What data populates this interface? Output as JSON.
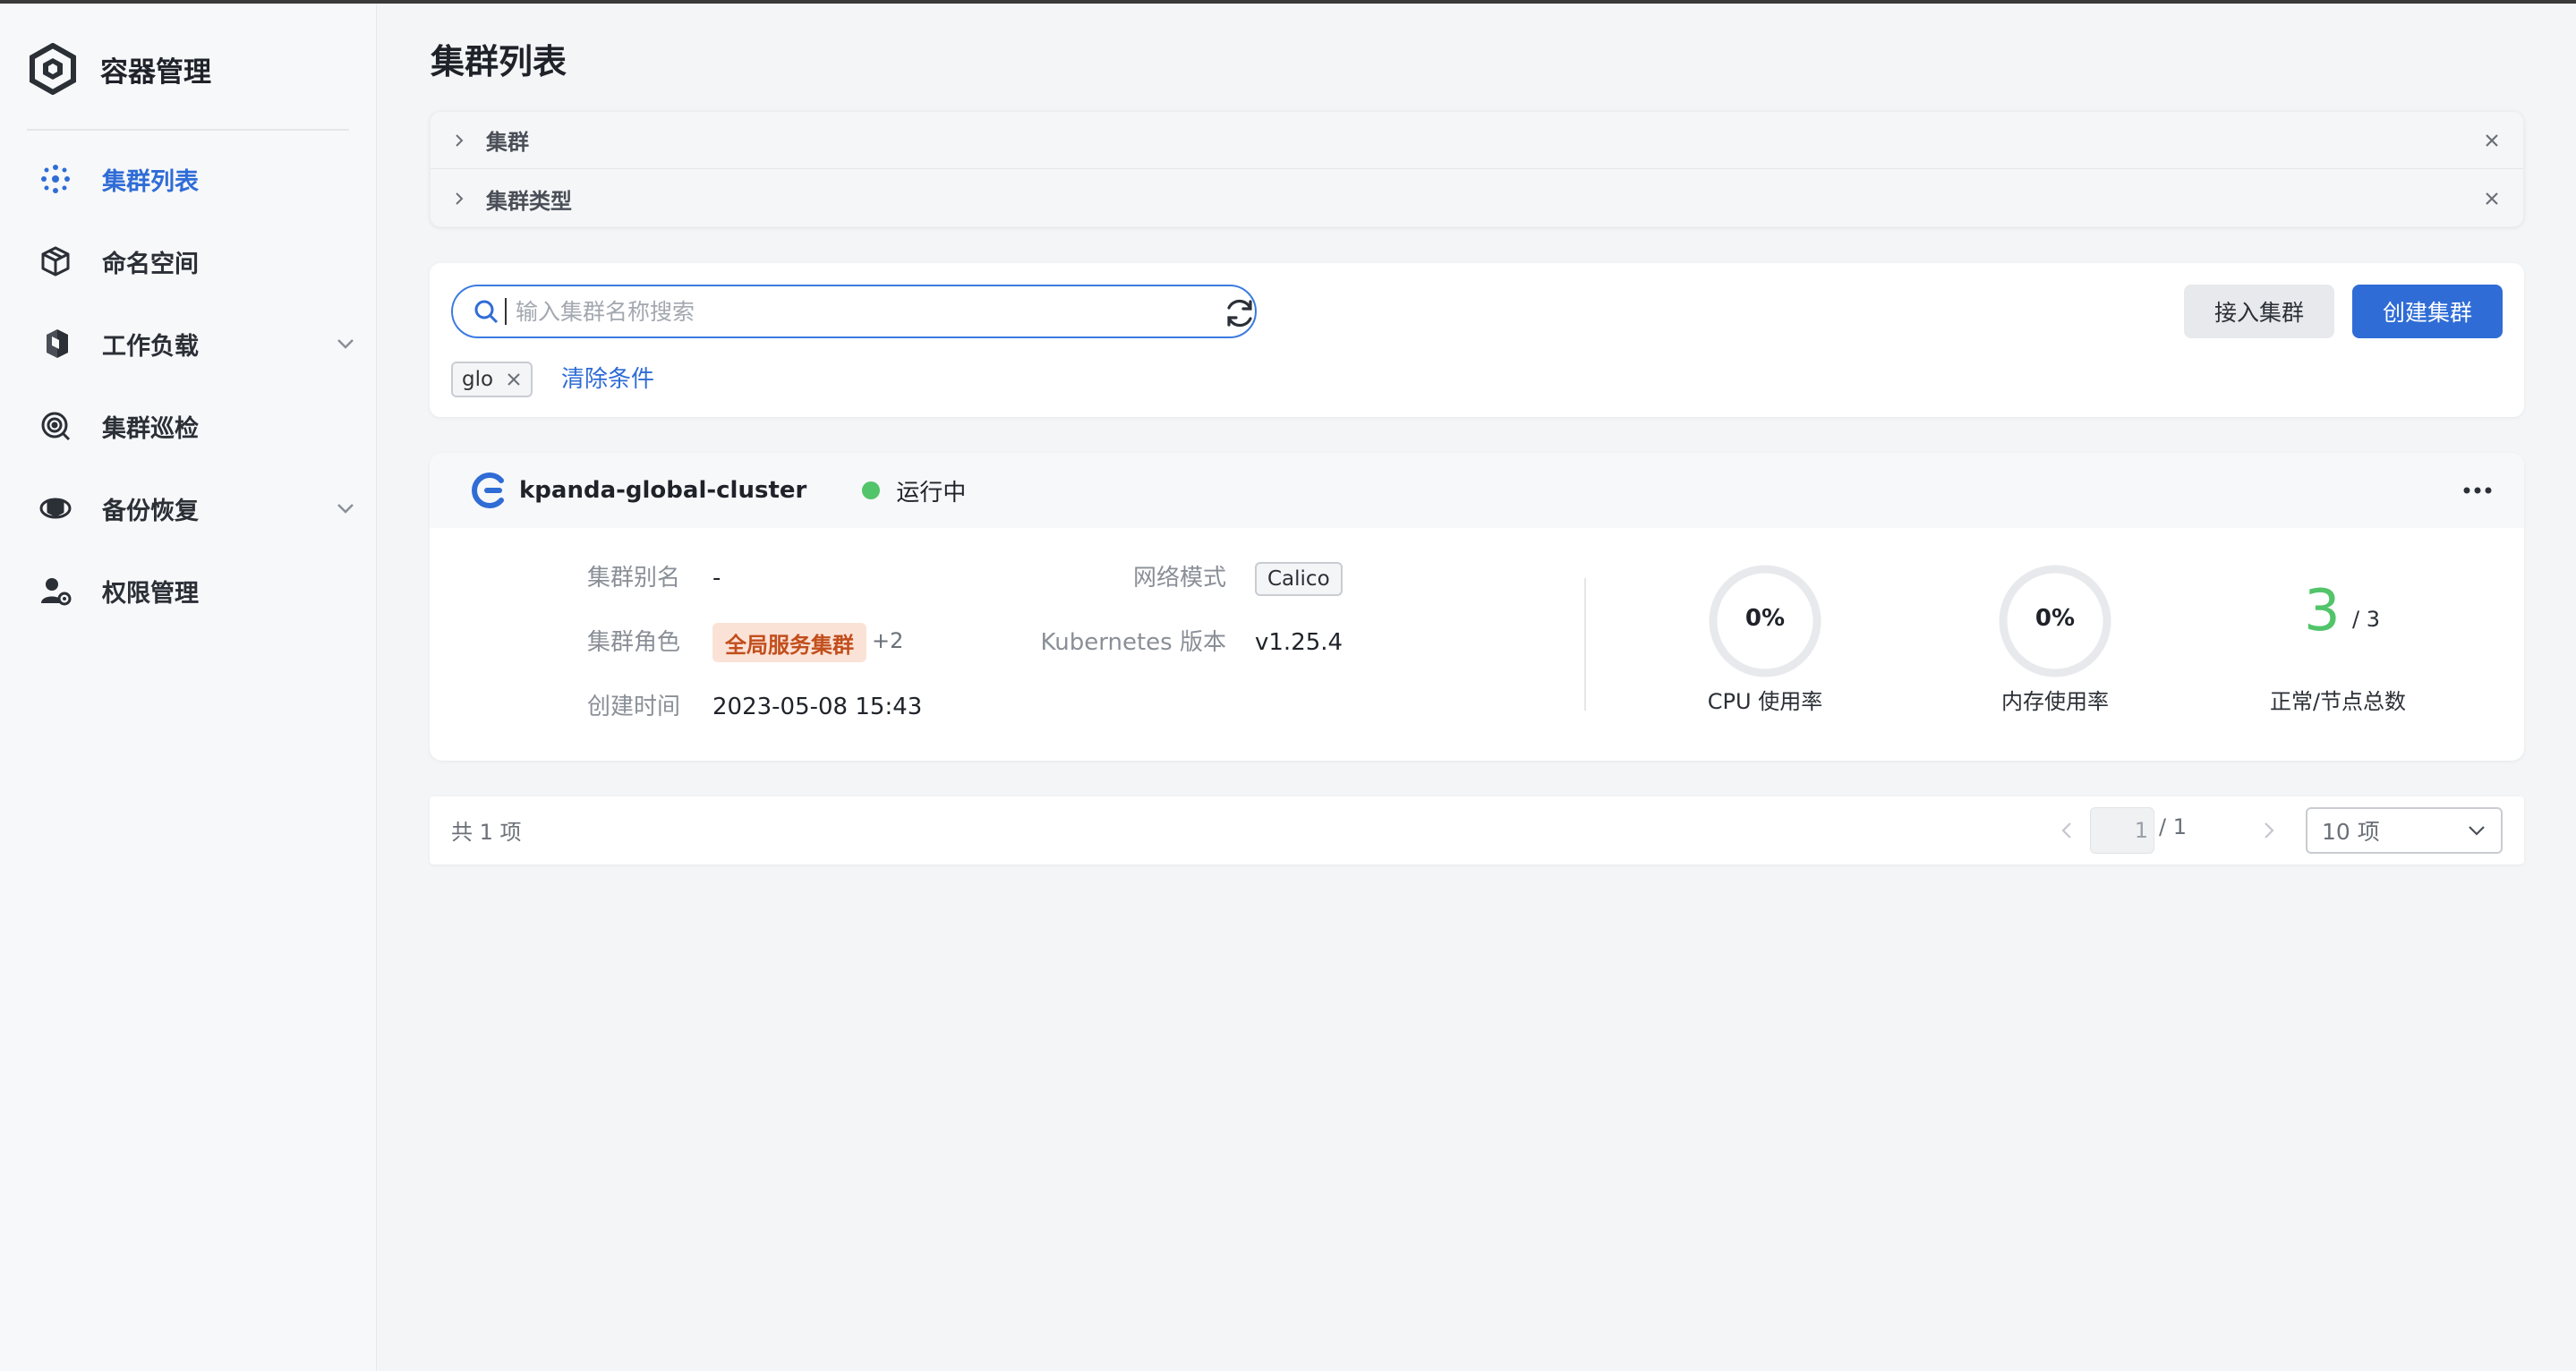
{
  "app": {
    "title": "容器管理"
  },
  "sidebar": {
    "items": [
      {
        "label": "集群列表",
        "icon": "cluster-icon",
        "active": true,
        "expandable": false
      },
      {
        "label": "命名空间",
        "icon": "cube-icon",
        "active": false,
        "expandable": false
      },
      {
        "label": "工作负载",
        "icon": "workload-icon",
        "active": false,
        "expandable": true
      },
      {
        "label": "集群巡检",
        "icon": "inspection-icon",
        "active": false,
        "expandable": false
      },
      {
        "label": "备份恢复",
        "icon": "backup-icon",
        "active": false,
        "expandable": true
      },
      {
        "label": "权限管理",
        "icon": "user-permission-icon",
        "active": false,
        "expandable": false
      }
    ]
  },
  "page": {
    "title": "集群列表"
  },
  "filters": [
    {
      "label": "集群"
    },
    {
      "label": "集群类型"
    }
  ],
  "toolbar": {
    "search_placeholder": "输入集群名称搜索",
    "search_value": "",
    "connect_label": "接入集群",
    "create_label": "创建集群",
    "tag": "glo",
    "clear_label": "清除条件"
  },
  "cluster": {
    "name": "kpanda-global-cluster",
    "status": "运行中",
    "alias_label": "集群别名",
    "alias_value": "-",
    "role_label": "集群角色",
    "role_value": "全局服务集群",
    "role_more": "+2",
    "created_label": "创建时间",
    "created_value": "2023-05-08 15:43",
    "network_label": "网络模式",
    "network_value": "Calico",
    "k8s_label": "Kubernetes 版本",
    "k8s_value": "v1.25.4",
    "cpu_value": "0%",
    "cpu_fraction": 0,
    "cpu_label": "CPU 使用率",
    "mem_value": "0%",
    "mem_fraction": 0,
    "mem_label": "内存使用率",
    "nodes_ready": "3",
    "nodes_total": "/ 3",
    "nodes_label": "正常/节点总数"
  },
  "pagination": {
    "total_text": "共 1 项",
    "page_value": "1",
    "page_total": "/ 1",
    "page_size": "10 项"
  },
  "colors": {
    "accent": "#2f6cd6",
    "success": "#52c46a",
    "role_badge_bg": "#fbe2d7",
    "role_badge_text": "#c24e1c"
  }
}
